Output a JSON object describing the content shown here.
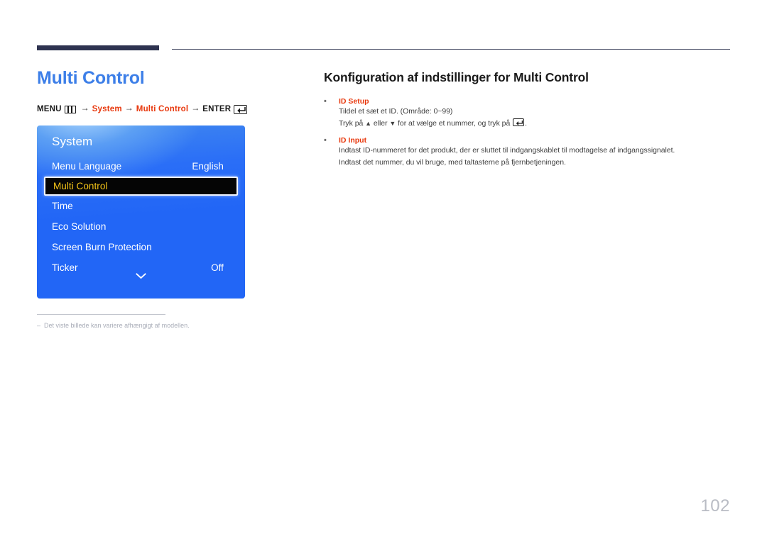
{
  "page": {
    "number": "102"
  },
  "left": {
    "title": "Multi Control",
    "breadcrumb": {
      "menu_label": "MENU",
      "menu_icon": "menu-grid-icon",
      "arrow": "→",
      "step1": "System",
      "step2": "Multi Control",
      "enter_label": "ENTER",
      "enter_icon": "enter-return-icon"
    },
    "osd": {
      "header": "System",
      "rows": [
        {
          "label": "Menu Language",
          "value": "English",
          "selected": false
        },
        {
          "label": "Multi Control",
          "value": "",
          "selected": true
        },
        {
          "label": "Time",
          "value": "",
          "selected": false
        },
        {
          "label": "Eco Solution",
          "value": "",
          "selected": false
        },
        {
          "label": "Screen Burn Protection",
          "value": "",
          "selected": false
        },
        {
          "label": "Ticker",
          "value": "Off",
          "selected": false
        }
      ],
      "scroll_icon": "chevron-down-icon",
      "colors": {
        "panel_top": "#7ab8f0",
        "panel_bottom": "#2266f6",
        "selected_bg": "#050505",
        "selected_text": "#f5c518",
        "selected_border": "#f2f6ff"
      }
    },
    "footnote": {
      "dash": "–",
      "text": "Det viste billede kan variere afhængigt af modellen."
    }
  },
  "right": {
    "section_title": "Konfiguration af indstillinger for Multi Control",
    "bullets": [
      {
        "heading": "ID Setup",
        "lines": [
          {
            "parts": [
              {
                "t": "Tildel et sæt et ID.  (Område: 0~99)"
              }
            ]
          },
          {
            "parts": [
              {
                "t": "Tryk på "
              },
              {
                "t": "▲",
                "style": "tri"
              },
              {
                "t": " eller "
              },
              {
                "t": "▼",
                "style": "tri"
              },
              {
                "t": " for at vælge et nummer, og tryk på "
              },
              {
                "t": "",
                "icon": "enter-return-icon"
              },
              {
                "t": "."
              }
            ]
          }
        ]
      },
      {
        "heading": "ID Input",
        "lines": [
          {
            "parts": [
              {
                "t": "Indtast ID-nummeret for det produkt, der er sluttet til indgangskablet til modtagelse af indgangssignalet."
              }
            ]
          },
          {
            "parts": [
              {
                "t": "Indtast det nummer, du vil bruge, med taltasterne på fjernbetjeningen."
              }
            ]
          }
        ]
      }
    ],
    "bullet_marker": "•",
    "colors": {
      "heading": "#e8380d",
      "body": "#3f3f3f"
    }
  },
  "theme": {
    "rule_navy": "#2e3350",
    "title_blue": "#3d7fe8",
    "page_number_gray": "#b9bcc4"
  }
}
